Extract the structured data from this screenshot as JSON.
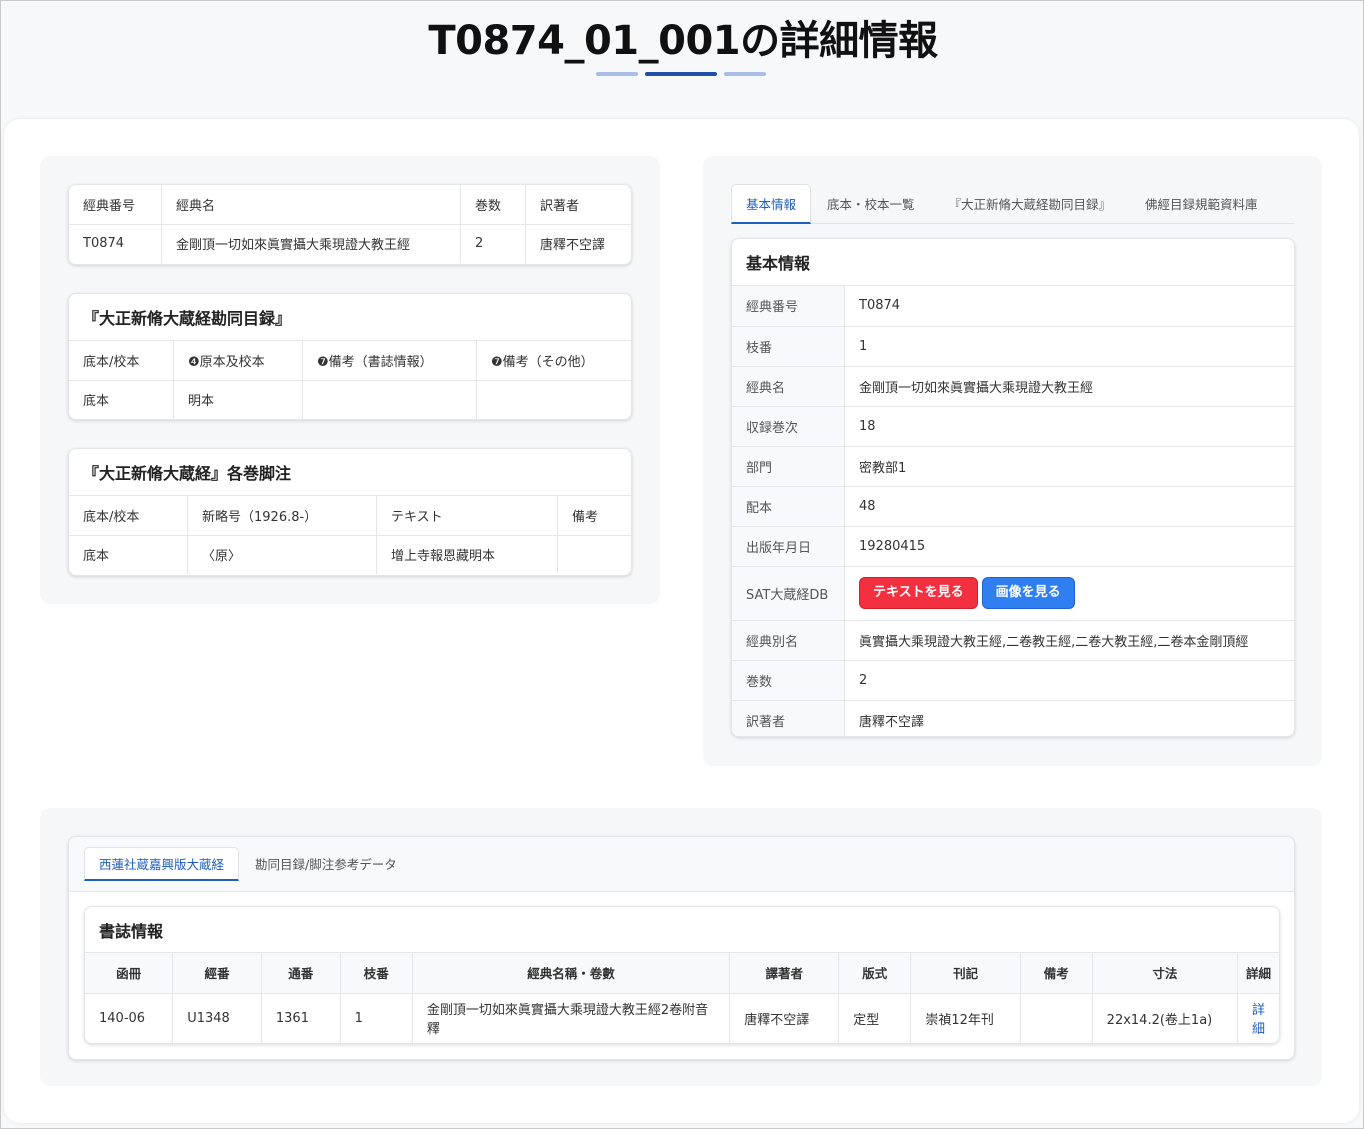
{
  "page": {
    "title": "T0874_01_001の詳細情報"
  },
  "summary_table": {
    "headers": [
      "經典番号",
      "經典名",
      "巻数",
      "訳著者"
    ],
    "row": [
      "T0874",
      "金剛頂一切如來眞實攝大乘現證大教王經",
      "2",
      "唐釋不空譯"
    ]
  },
  "kando_mokuroku": {
    "title": "『大正新脩大蔵経勘同目録』",
    "headers": [
      "底本/校本",
      "❹原本及校本",
      "❼備考（書誌情報）",
      "❼備考（その他）"
    ],
    "row": [
      "底本",
      "明本",
      "",
      ""
    ]
  },
  "footnotes": {
    "title": "『大正新脩大蔵経』各巻脚注",
    "headers": [
      "底本/校本",
      "新略号（1926.8-）",
      "テキスト",
      "備考"
    ],
    "row": [
      "底本",
      "〈原〉",
      "增上寺報恩藏明本",
      ""
    ]
  },
  "right_tabs": [
    "基本情報",
    "底本・校本一覧",
    "『大正新脩大蔵経勘同目録』",
    "佛經目録規範資料庫"
  ],
  "basic_info": {
    "title": "基本情報",
    "rows": [
      {
        "key": "經典番号",
        "value": "T0874"
      },
      {
        "key": "枝番",
        "value": "1"
      },
      {
        "key": "經典名",
        "value": "金剛頂一切如來眞實攝大乘現證大教王經"
      },
      {
        "key": "収録巻次",
        "value": "18"
      },
      {
        "key": "部門",
        "value": "密教部1"
      },
      {
        "key": "配本",
        "value": "48"
      },
      {
        "key": "出版年月日",
        "value": "19280415"
      }
    ],
    "sat_label": "SAT大蔵経DB",
    "sat_text_button": "テキストを見る",
    "sat_image_button": "画像を見る",
    "rows2": [
      {
        "key": "經典別名",
        "value": "眞實攝大乘現證大教王經,二卷教王經,二卷大教王經,二卷本金剛頂經"
      },
      {
        "key": "巻数",
        "value": "2"
      },
      {
        "key": "訳著者",
        "value": "唐釋不空譯"
      }
    ],
    "colors": {
      "text_button": "#f23040",
      "image_button": "#2f7ff0"
    }
  },
  "bottom_tabs": [
    "西蓮社蔵嘉興版大蔵経",
    "勘同目録/脚注参考データ"
  ],
  "bibliography": {
    "title": "書誌情報",
    "headers": [
      "函冊",
      "經番",
      "通番",
      "枝番",
      "經典名稱・卷數",
      "譯著者",
      "版式",
      "刊記",
      "備考",
      "寸法",
      "詳細"
    ],
    "row": [
      "140-06",
      "U1348",
      "1361",
      "1",
      "金剛頂一切如來眞實攝大乘現證大教王經2卷附音釋",
      "唐釋不空譯",
      "定型",
      "崇禎12年刊",
      "",
      "22x14.2(卷上1a)",
      "詳細"
    ]
  },
  "accent_color": "#1f5fbf"
}
